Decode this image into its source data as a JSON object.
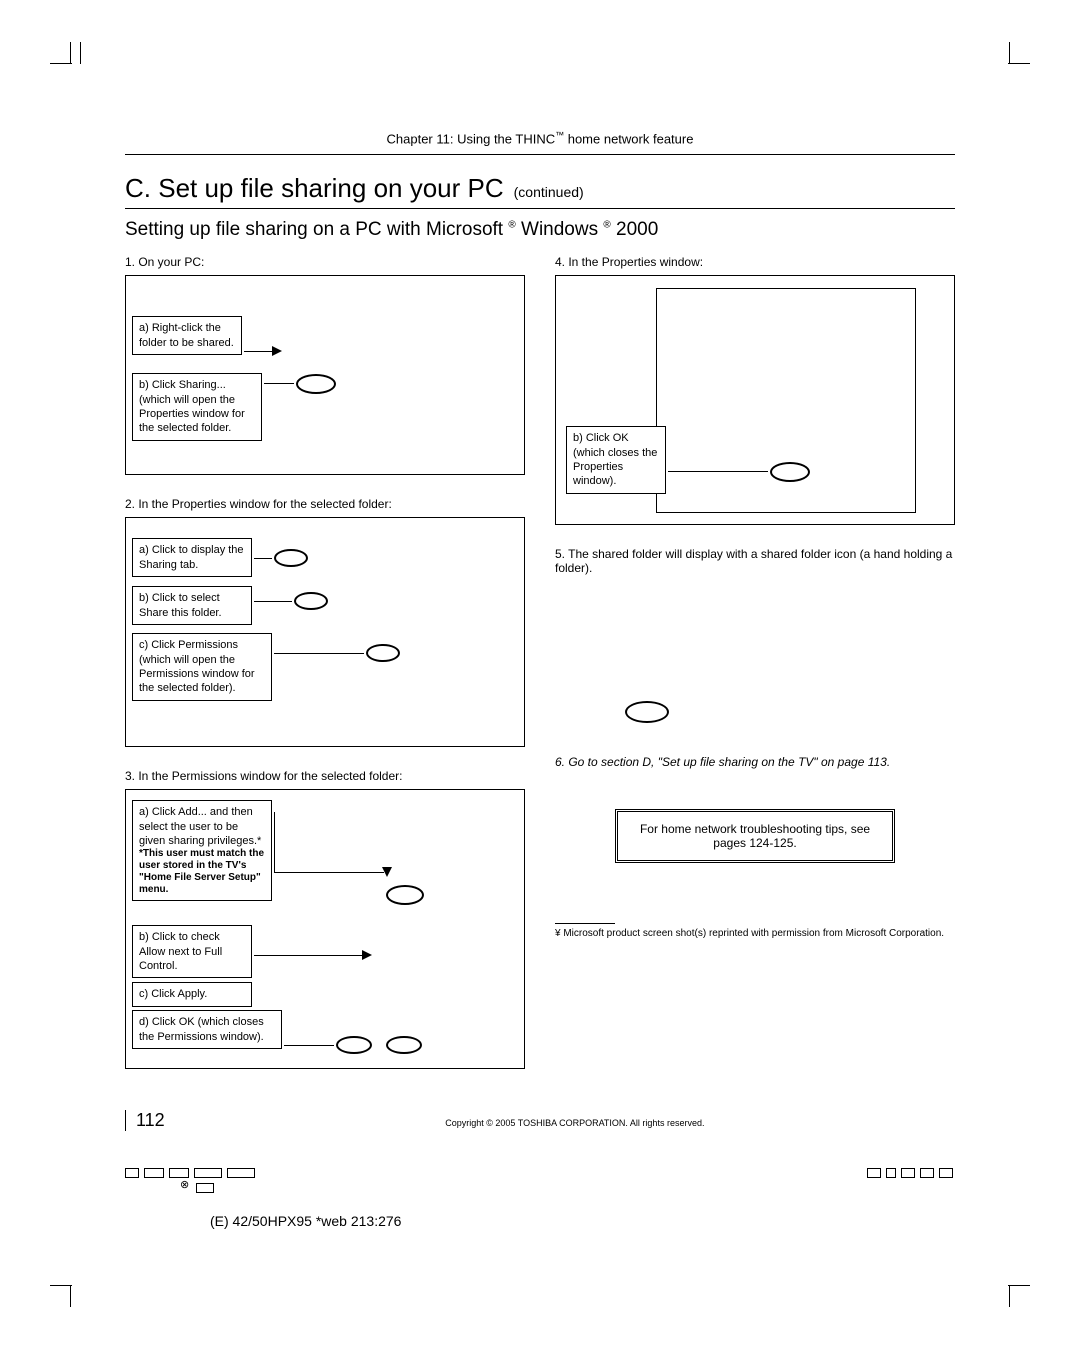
{
  "chapter": {
    "prefix": "Chapter 11: Using the THINC",
    "tm": "™",
    "suffix": " home network feature"
  },
  "heading": {
    "letter_title": "C.  Set up file sharing on your PC",
    "continued": "(continued)"
  },
  "subheading": {
    "pre": "Setting up file sharing on a PC with Microsoft ",
    "r1": "®",
    "mid": " Windows ",
    "r2": "®",
    "tail": " 2000"
  },
  "left": {
    "step1": "1.  On your PC:",
    "c1a": "a) Right-click the folder to be shared.",
    "c1b": "b) Click  Sharing... (which will open the Properties window for the selected folder.",
    "step2": "2.  In the Properties window for the selected folder:",
    "c2a": "a) Click to display the  Sharing  tab.",
    "c2b": "b) Click to select Share this folder.",
    "c2c": "c) Click  Permissions (which will open the Permissions window for the selected folder).",
    "step3": "3.  In the Permissions window for the selected folder:",
    "c3a": "a) Click  Add... and then select the user to be given sharing privileges.*",
    "c3note": "*This user must match the user stored in the TV's \"Home File Server Setup\" menu.",
    "c3b": "b) Click to check Allow  next to Full Control.",
    "c3c": "c) Click  Apply.",
    "c3d": "d) Click  OK (which closes the Permissions window)."
  },
  "right": {
    "step4": "4.  In the Properties window:",
    "c4b": "b) Click  OK (which closes the Properties window).",
    "step5": "5.  The shared folder will display with a  shared folder  icon (a hand holding a folder).",
    "step6": "6.  Go to section D, \"Set up file sharing on the TV\" on page 113.",
    "tip": "For home network troubleshooting tips, see pages 124-125.",
    "ms_bullet": "¥",
    "ms_text": "Microsoft product screen shot(s) reprinted with permission from Microsoft Corporation."
  },
  "footer": {
    "page_number": "112",
    "copyright": "Copyright © 2005 TOSHIBA CORPORATION. All rights reserved.",
    "bottom_label": "(E) 42/50HPX95 *web 213:276"
  }
}
